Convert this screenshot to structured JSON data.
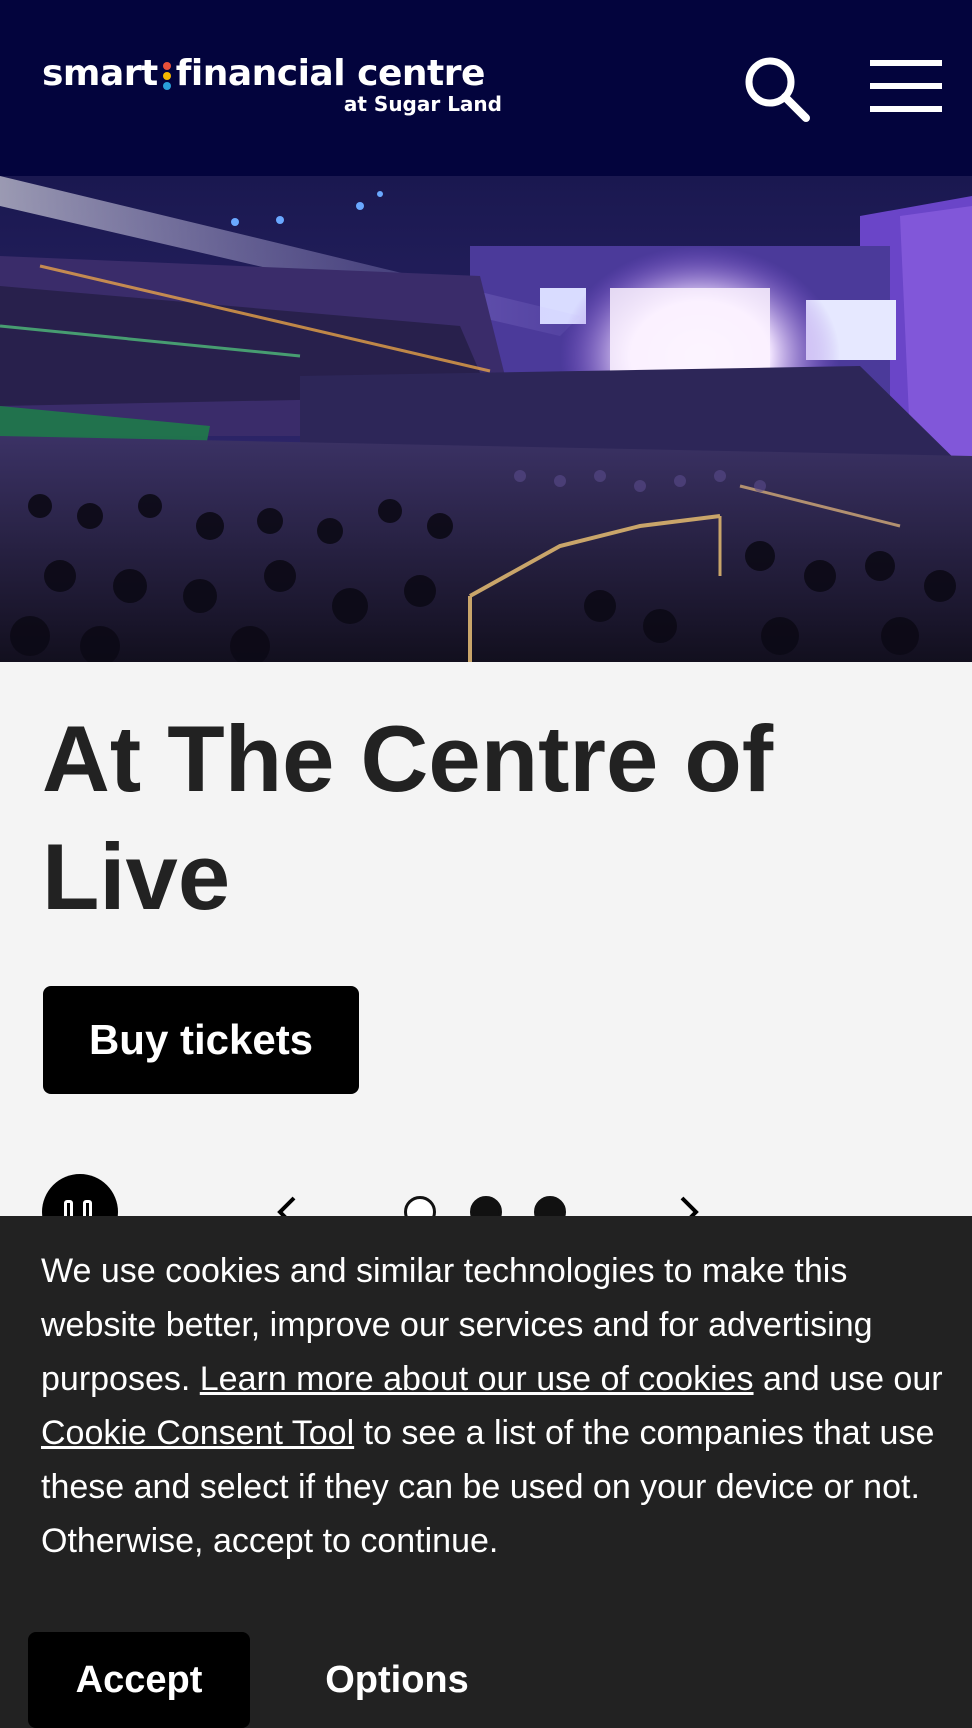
{
  "header": {
    "logo_main_left": "smart",
    "logo_main_right": "financial centre",
    "logo_sub": "at Sugar Land",
    "logo_dot_colors": [
      "#e8503a",
      "#f5b800",
      "#2a9fd8"
    ],
    "background": "#03043d",
    "search_icon": "search-icon",
    "menu_icon": "hamburger-menu-icon"
  },
  "hero": {
    "image": "arena-concert-crowd-photo"
  },
  "main": {
    "headline": "At The Centre of Live",
    "buy_button": "Buy tickets"
  },
  "carousel": {
    "pause_icon": "pause-icon",
    "prev_icon": "chevron-left-icon",
    "next_icon": "chevron-right-icon",
    "slide_count": 3,
    "active_slide": 1
  },
  "cookie_banner": {
    "text_before": "We use cookies and similar technologies to make this website better, improve our services and for advertising purposes. ",
    "link_learn_more": "Learn more about our use of cookies",
    "text_middle": " and use our ",
    "link_consent_tool": "Cookie Consent Tool",
    "text_after": " to see a list of the companies that use these and select if they can be used on your device or not. Otherwise, accept to continue.",
    "accept_button": "Accept",
    "options_button": "Options",
    "background": "#222222"
  }
}
